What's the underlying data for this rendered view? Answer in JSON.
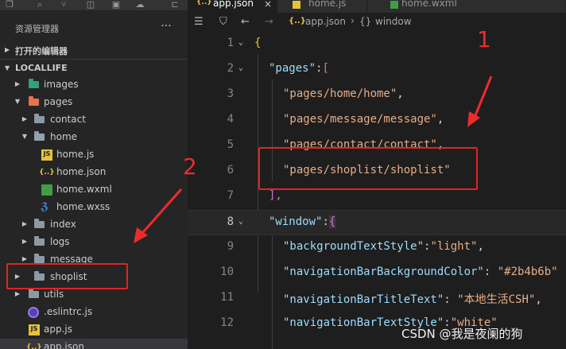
{
  "explorer": {
    "title": "资源管理器",
    "more": "···",
    "open_editors_label": "打开的编辑器",
    "project_label": "LOCALLIFE"
  },
  "tree": {
    "images": "images",
    "pages": "pages",
    "contact": "contact",
    "home": "home",
    "home_js": "home.js",
    "home_json": "home.json",
    "home_wxml": "home.wxml",
    "home_wxss": "home.wxss",
    "index": "index",
    "logs": "logs",
    "message": "message",
    "shoplist": "shoplist",
    "utils": "utils",
    "eslintrc": ".eslintrc.js",
    "app_js": "app.js",
    "app_json": "app.json"
  },
  "tabs": [
    {
      "label": "app.json",
      "icon": "json-icon",
      "active": true,
      "close": "×"
    },
    {
      "label": "home.js",
      "icon": "js-icon",
      "active": false
    },
    {
      "label": "home.wxml",
      "icon": "wxml-icon",
      "active": false
    }
  ],
  "breadcrumb": {
    "file_icon": "{..}",
    "file": "app.json",
    "sep": "›",
    "obj_icon": "{}",
    "obj": "window"
  },
  "code": {
    "l1": "{",
    "l2_key": "\"pages\"",
    "l2_rest": ":[",
    "l3": "\"pages/home/home\"",
    "l4": "\"pages/message/message\"",
    "l5": "\"pages/contact/contact\"",
    "l6": "\"pages/shoplist/shoplist\"",
    "l7": "],",
    "l8_key": "\"window\"",
    "l8_rest": ":{",
    "l9_key": "\"backgroundTextStyle\"",
    "l9_val": "\"light\"",
    "l10_key": "\"navigationBarBackgroundColor\"",
    "l10_val": "\"#2b4b6b\"",
    "l11_key": "\"navigationBarTitleText\"",
    "l11_val": "\"本地生活CSH\"",
    "l12_key": "\"navigationBarTextStyle\"",
    "l12_val": "\"white\"",
    "comma": ",",
    "colon": ":",
    "colon_sp": ": "
  },
  "line_numbers": [
    "1",
    "2",
    "3",
    "4",
    "5",
    "6",
    "7",
    "8",
    "9",
    "10",
    "11",
    "12"
  ],
  "annotations": {
    "one": "1",
    "two": "2"
  },
  "watermark": "CSDN @我是夜阑的狗",
  "colors": {
    "annotation": "#e32222",
    "string": "#ce9178",
    "key": "#9cdcfe"
  }
}
